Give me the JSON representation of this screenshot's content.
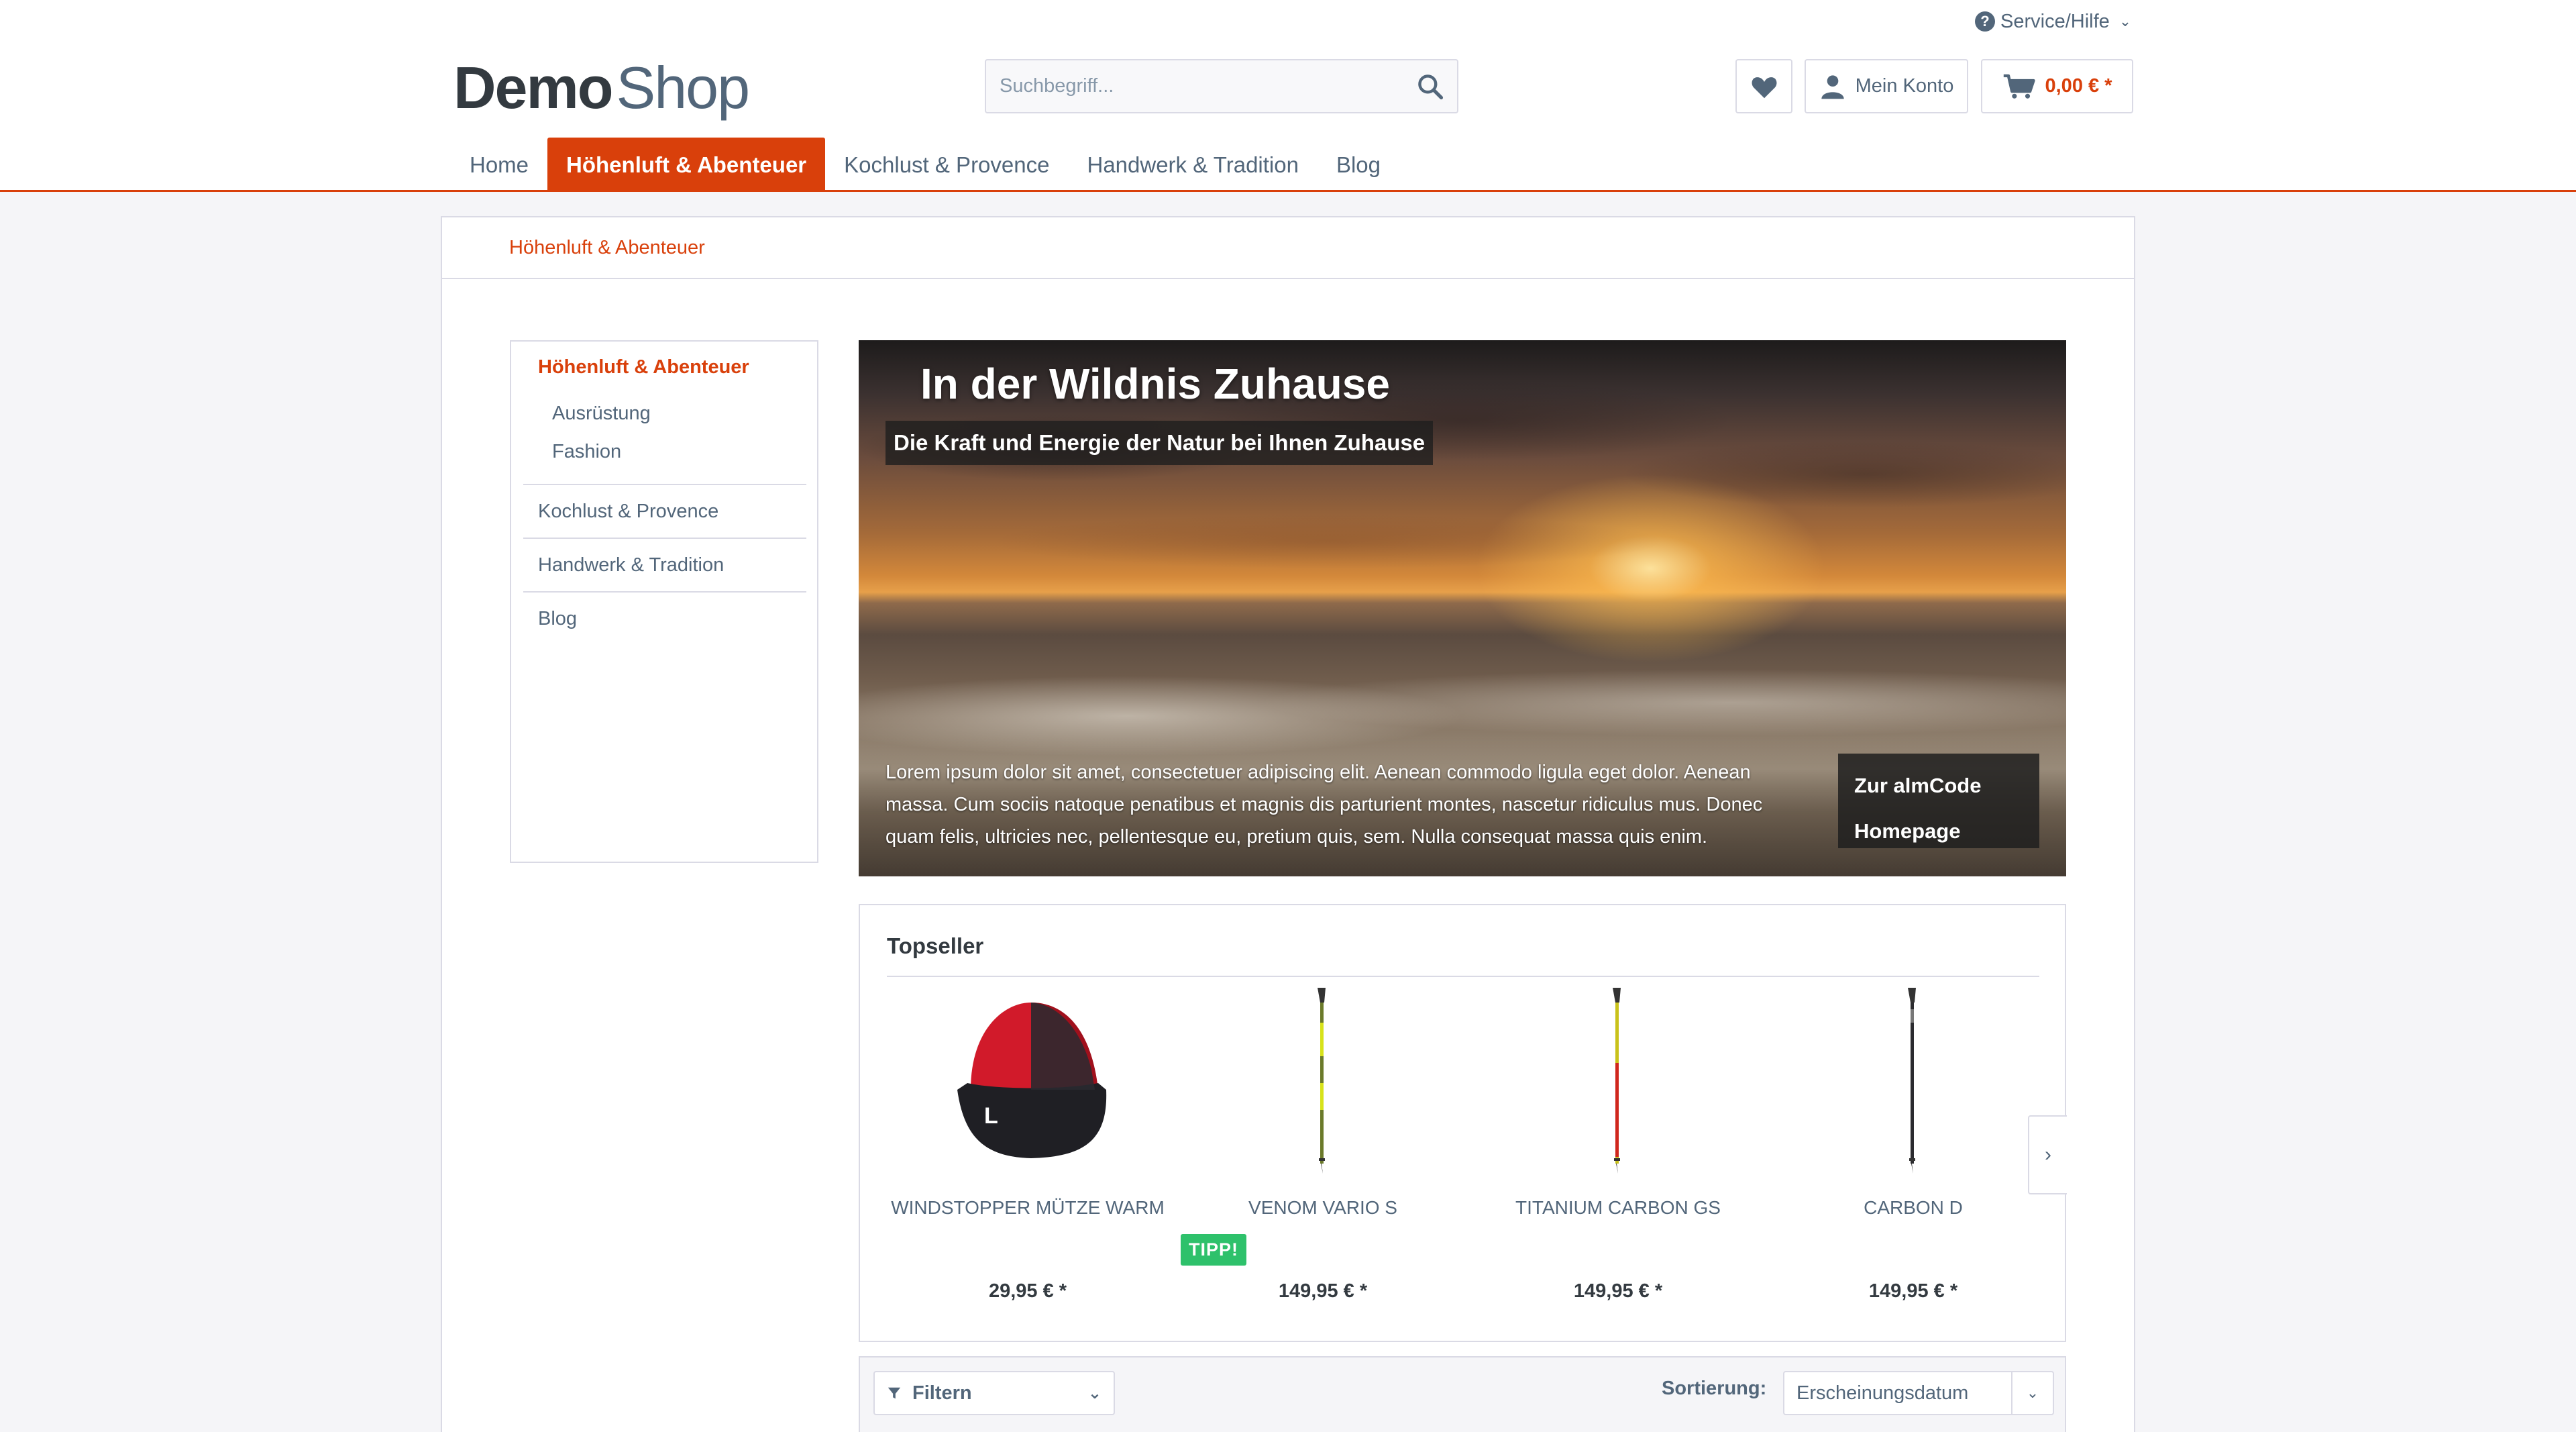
{
  "header": {
    "service_label": "Service/Hilfe",
    "logo": {
      "part1": "Demo",
      "part2": "Shop"
    },
    "search": {
      "placeholder": "Suchbegriff..."
    },
    "account_label": "Mein Konto",
    "cart_price": "0,00 € *"
  },
  "nav": {
    "items": [
      {
        "label": "Home"
      },
      {
        "label": "Höhenluft & Abenteuer"
      },
      {
        "label": "Kochlust & Provence"
      },
      {
        "label": "Handwerk & Tradition"
      },
      {
        "label": "Blog"
      }
    ]
  },
  "breadcrumb": "Höhenluft & Abenteuer",
  "sidebar": {
    "active": "Höhenluft & Abenteuer",
    "sub": [
      "Ausrüstung",
      "Fashion"
    ],
    "categories": [
      "Kochlust & Provence",
      "Handwerk & Tradition",
      "Blog"
    ]
  },
  "hero": {
    "title": "In der Wildnis Zuhause",
    "subtitle": "Die Kraft und Energie der Natur bei Ihnen Zuhause",
    "text": "Lorem ipsum dolor sit amet, consectetuer adipiscing elit. Aenean commodo ligula eget dolor. Aenean massa. Cum sociis natoque penatibus et magnis dis parturient montes, nascetur ridiculus mus. Donec quam felis, ultricies nec, pellentesque eu, pretium quis, sem. Nulla consequat massa quis enim.",
    "cta_line1": "Zur almCode",
    "cta_line2": "Homepage"
  },
  "topseller": {
    "title": "Topseller",
    "badge": "TIPP!",
    "products": [
      {
        "name": "WINDSTOPPER MÜTZE WARM",
        "price": "29,95 € *"
      },
      {
        "name": "VENOM VARIO S",
        "price": "149,95 € *"
      },
      {
        "name": "TITANIUM CARBON GS",
        "price": "149,95 € *"
      },
      {
        "name": "CARBON D",
        "price": "149,95 € *"
      }
    ]
  },
  "filterbar": {
    "filter_label": "Filtern",
    "sort_label": "Sortierung:",
    "sort_value": "Erscheinungsdatum"
  },
  "colors": {
    "accent": "#d9400b",
    "text": "#52667a",
    "border": "#dadae5",
    "badge": "#2ec16b"
  }
}
